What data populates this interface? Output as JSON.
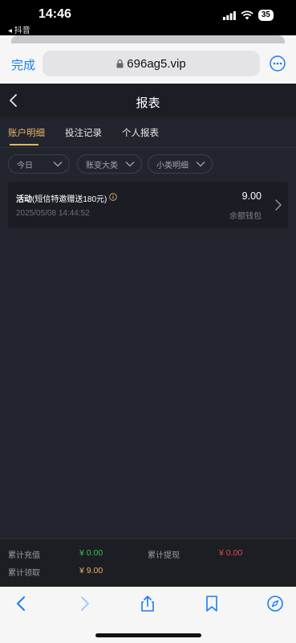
{
  "status": {
    "time": "14:46",
    "back_app": "◂ 抖音",
    "battery": "35"
  },
  "browser": {
    "done": "完成",
    "url": "696ag5.vip"
  },
  "header": {
    "title": "报表"
  },
  "tabs": [
    {
      "label": "账户明细",
      "active": true
    },
    {
      "label": "投注记录",
      "active": false
    },
    {
      "label": "个人报表",
      "active": false
    }
  ],
  "filters": [
    {
      "label": "今日"
    },
    {
      "label": "账变大类"
    },
    {
      "label": "小类明细"
    }
  ],
  "record": {
    "title_bold": "活动",
    "title_note": "(短信特邀赠送180元)",
    "amount": "9.00",
    "date": "2025/05/08 14:44:52",
    "wallet": "余额钱包"
  },
  "totals": {
    "recharge_label": "累计充值",
    "recharge_value": "¥ 0.00",
    "withdraw_label": "累计提现",
    "withdraw_value": "¥ 0.00",
    "claim_label": "累计领取",
    "claim_value": "¥ 9.00"
  },
  "colors": {
    "accent_gold": "#e7b367",
    "positive_green": "#37c24a",
    "negative_red": "#e5484d",
    "link_blue": "#1a7cf4"
  }
}
